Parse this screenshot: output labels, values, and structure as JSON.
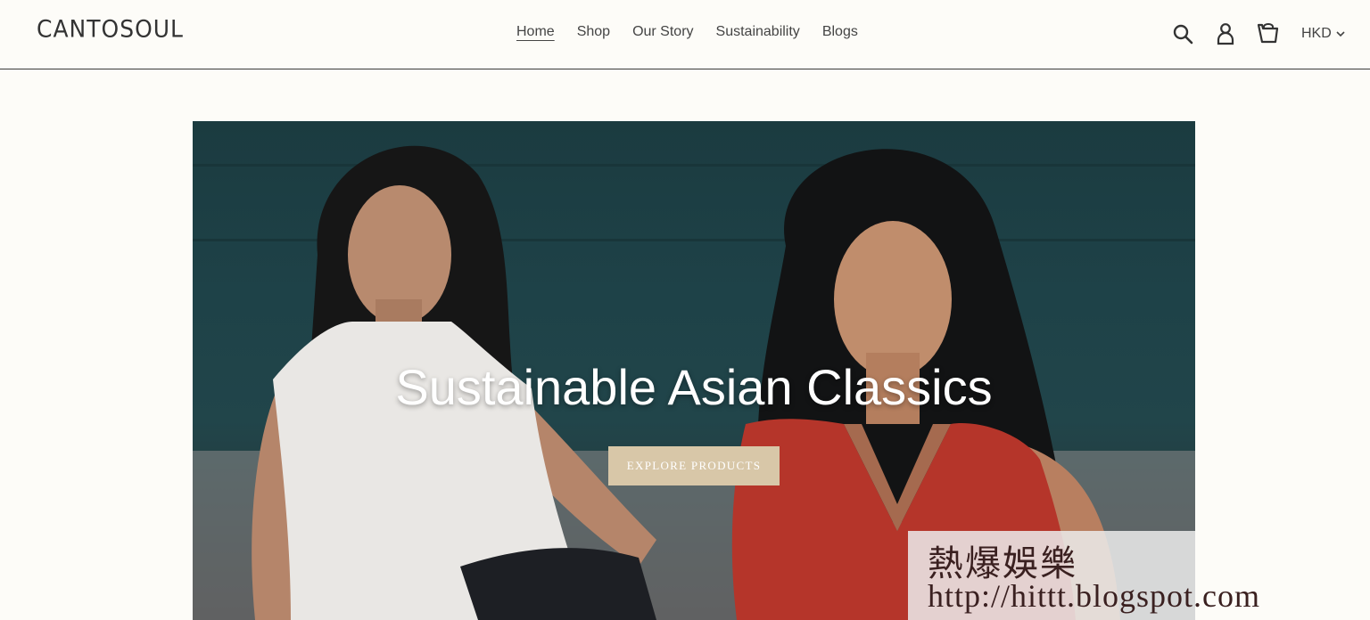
{
  "brand": {
    "logo_text": "CANTOSOUL"
  },
  "nav": {
    "items": [
      {
        "label": "Home",
        "active": true
      },
      {
        "label": "Shop"
      },
      {
        "label": "Our Story"
      },
      {
        "label": "Sustainability"
      },
      {
        "label": "Blogs"
      }
    ]
  },
  "header_icons": [
    "search-icon",
    "account-icon",
    "cart-icon"
  ],
  "currency": {
    "selected": "HKD"
  },
  "hero": {
    "title": "Sustainable Asian Classics",
    "cta_label": "EXPLORE PRODUCTS"
  },
  "watermark": {
    "line1": "熱爆娛樂",
    "line2": "http://hittt.blogspot.com"
  },
  "colors": {
    "background": "#fdfcf8",
    "cta_bg": "#d8c7a8",
    "hero_wall": "#1e4248"
  }
}
